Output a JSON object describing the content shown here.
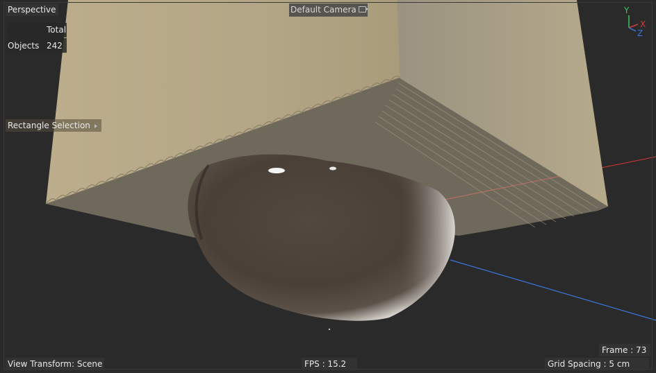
{
  "viewport": {
    "name": "Perspective",
    "camera": "Default Camera",
    "stats": {
      "column_header": "Total",
      "rows": [
        {
          "label": "Objects",
          "value": "242"
        }
      ]
    },
    "selection_tool": "Rectangle Selection",
    "frame": "Frame : 73",
    "view_transform": "View Transform: Scene",
    "fps": "FPS : 15.2",
    "grid_spacing": "Grid Spacing : 5 cm",
    "axis_gizmo": {
      "x": "X",
      "y": "Y",
      "z": "Z"
    },
    "colors": {
      "background": "#2a2a2a",
      "box_front": "#b1a585",
      "box_side": "#a49b84",
      "object": "#4b4139",
      "x_axis": "#d93a3a",
      "y_axis": "#3ec55a",
      "z_axis": "#3a78e0"
    }
  }
}
